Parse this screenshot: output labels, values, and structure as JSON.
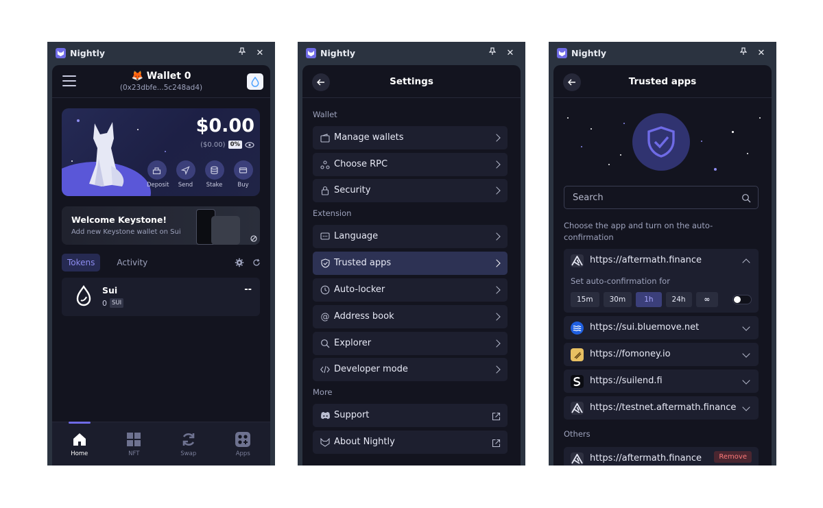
{
  "app": {
    "title": "Nightly",
    "pin_icon": "pin-icon",
    "close_icon": "close-icon"
  },
  "home": {
    "wallet_name": "Wallet 0",
    "wallet_address": "(0x23dbfe...5c248ad4)",
    "balance": "$0.00",
    "balance_sub": "($0.00)",
    "change_pct": "0%",
    "actions": [
      {
        "label": "Deposit",
        "icon": "deposit-icon"
      },
      {
        "label": "Send",
        "icon": "send-icon"
      },
      {
        "label": "Stake",
        "icon": "stake-icon"
      },
      {
        "label": "Buy",
        "icon": "buy-icon"
      }
    ],
    "promo": {
      "title": "Welcome Keystone!",
      "subtitle": "Add new Keystone wallet on Sui"
    },
    "tabs": [
      {
        "label": "Tokens",
        "active": true
      },
      {
        "label": "Activity",
        "active": false
      }
    ],
    "token": {
      "name": "Sui",
      "amount": "0",
      "symbol": "SUI",
      "value": "--"
    },
    "nav": [
      {
        "label": "Home",
        "active": true
      },
      {
        "label": "NFT",
        "active": false
      },
      {
        "label": "Swap",
        "active": false
      },
      {
        "label": "Apps",
        "active": false
      }
    ]
  },
  "settings": {
    "title": "Settings",
    "sections": {
      "wallet": "Wallet",
      "extension": "Extension",
      "more": "More"
    },
    "items": {
      "manage_wallets": "Manage wallets",
      "choose_rpc": "Choose RPC",
      "security": "Security",
      "language": "Language",
      "trusted_apps": "Trusted apps",
      "auto_locker": "Auto-locker",
      "address_book": "Address book",
      "explorer": "Explorer",
      "developer_mode": "Developer mode",
      "support": "Support",
      "about": "About Nightly"
    }
  },
  "trusted": {
    "title": "Trusted apps",
    "search_placeholder": "Search",
    "description": "Choose the app and turn on the auto-confirmation",
    "auto_label": "Set auto-confirmation for",
    "durations": [
      "15m",
      "30m",
      "1h",
      "24h",
      "∞"
    ],
    "active_duration": "1h",
    "auto_enabled": false,
    "apps": [
      "https://aftermath.finance",
      "https://sui.bluemove.net",
      "https://fomoney.io",
      "https://suilend.fi",
      "https://testnet.aftermath.finance"
    ],
    "others_label": "Others",
    "others": [
      {
        "url": "https://aftermath.finance",
        "action": "Remove"
      }
    ]
  }
}
